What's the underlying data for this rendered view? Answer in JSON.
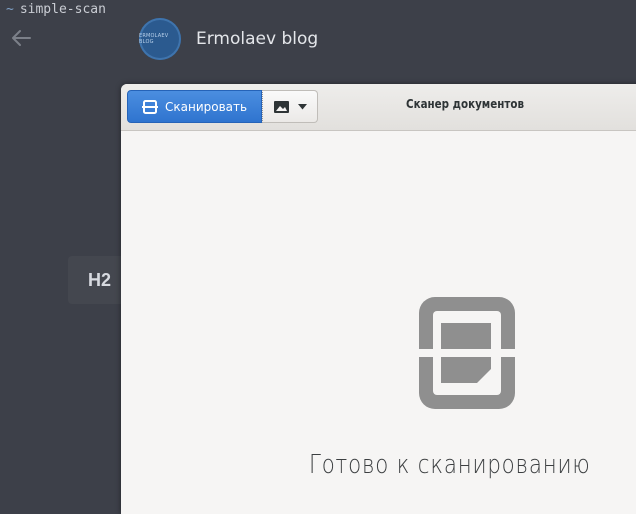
{
  "terminal": {
    "prompt": "~",
    "command": "simple-scan"
  },
  "blog": {
    "logo_text": "ERMOLAEV BLOG",
    "title": "Ermolaev blog",
    "heading_chip": "H2"
  },
  "scanner": {
    "title": "Сканер документов",
    "scan_label": "Сканировать",
    "status": "Готово к сканированию",
    "accent": "#3b82d8"
  },
  "icons": {
    "back": "arrow-left-icon",
    "scan": "scanner-icon",
    "image": "image-icon",
    "dropdown": "chevron-down-icon",
    "document": "document-icon"
  }
}
